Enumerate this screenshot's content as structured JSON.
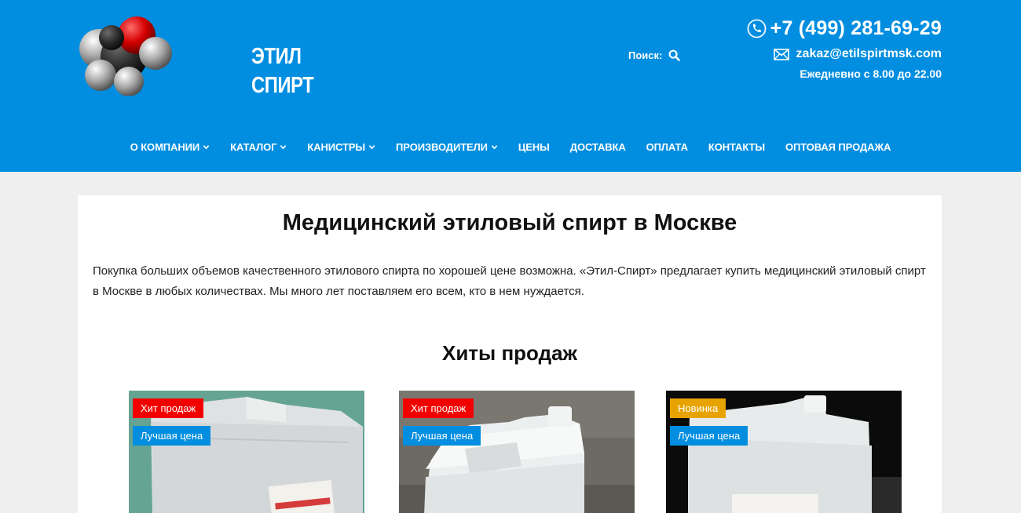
{
  "header": {
    "logo_line1": "ЭТИЛ",
    "logo_line2": "СПИРТ",
    "search_label": "Поиск:",
    "phone": "+7 (499) 281-69-29",
    "email": "zakaz@etilspirtmsk.com",
    "hours": "Ежедневно с 8.00 до 22.00"
  },
  "nav": [
    {
      "label": "О КОМПАНИИ",
      "has_dropdown": true
    },
    {
      "label": "КАТАЛОГ",
      "has_dropdown": true
    },
    {
      "label": "КАНИСТРЫ",
      "has_dropdown": true
    },
    {
      "label": "ПРОИЗВОДИТЕЛИ",
      "has_dropdown": true
    },
    {
      "label": "ЦЕНЫ",
      "has_dropdown": false
    },
    {
      "label": "ДОСТАВКА",
      "has_dropdown": false
    },
    {
      "label": "ОПЛАТА",
      "has_dropdown": false
    },
    {
      "label": "КОНТАКТЫ",
      "has_dropdown": false
    },
    {
      "label": "ОПТОВАЯ ПРОДАЖА",
      "has_dropdown": false
    }
  ],
  "main": {
    "title": "Медицинский этиловый спирт в Москве",
    "intro": "Покупка больших объемов качественного этилового спирта по хорошей цене возможна. «Этил-Спирт» предлагает купить медицинский этиловый спирт в Москве в любых количествах. Мы много лет поставляем его всем, кто в нем нуждается.",
    "section_title": "Хиты продаж",
    "products": [
      {
        "badges": [
          "Хит продаж",
          "Лучшая цена"
        ]
      },
      {
        "badges": [
          "Хит продаж",
          "Лучшая цена"
        ]
      },
      {
        "badges": [
          "Новинка",
          "Лучшая цена"
        ]
      }
    ]
  },
  "colors": {
    "brand_blue": "#018ee0",
    "badge_hit": "#f20000",
    "badge_new": "#e7a400",
    "page_bg": "#efefef"
  }
}
